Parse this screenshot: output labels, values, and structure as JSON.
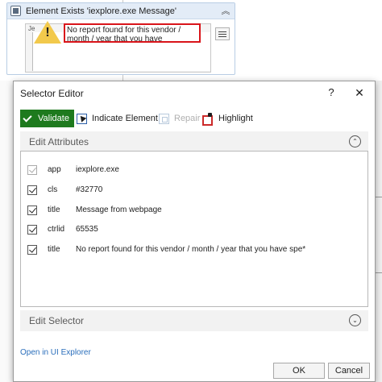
{
  "activity": {
    "title": "Element Exists 'iexplore.exe Message'",
    "collapse_icon": "double-chevron-up",
    "preview_tag": "Je",
    "preview_message": "No report found for this vendor / month / year that you have specified.",
    "warning_mark": "!"
  },
  "dialog": {
    "title": "Selector Editor",
    "help": "?",
    "close": "✕"
  },
  "toolbar": {
    "validate": "Validate",
    "indicate": "Indicate Element",
    "repair": "Repair",
    "highlight": "Highlight"
  },
  "edit_attributes": {
    "title": "Edit Attributes",
    "toggle": "⌃",
    "rows": [
      {
        "checked": true,
        "disabled": true,
        "name": "app",
        "value": "iexplore.exe"
      },
      {
        "checked": true,
        "disabled": false,
        "name": "cls",
        "value": "#32770"
      },
      {
        "checked": true,
        "disabled": false,
        "name": "title",
        "value": "Message from webpage"
      },
      {
        "checked": true,
        "disabled": false,
        "name": "ctrlid",
        "value": "65535"
      },
      {
        "checked": true,
        "disabled": false,
        "name": "title",
        "value": "No report found for this vendor / month / year that you have spe*"
      }
    ]
  },
  "edit_selector": {
    "title": "Edit Selector",
    "toggle": "⌄"
  },
  "footer": {
    "open_link": "Open in UI Explorer",
    "ok": "OK",
    "cancel": "Cancel"
  },
  "colors": {
    "validate_bg": "#1e7a1e",
    "link": "#2a6ebb",
    "highlight_frame": "#d9141a",
    "activity_header": "#e3ecf7"
  }
}
